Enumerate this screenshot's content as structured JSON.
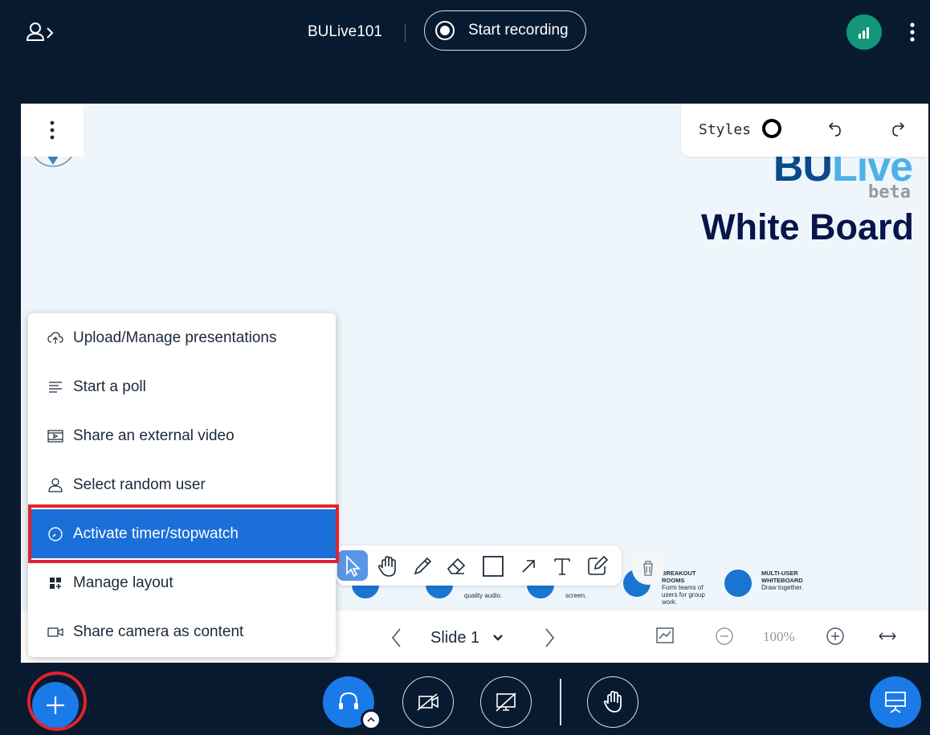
{
  "header": {
    "meeting_title": "BULive101",
    "record_label": "Start recording"
  },
  "presentation": {
    "styles_label": "Styles",
    "slide": {
      "brand_bu": "BU",
      "brand_live": "Live",
      "brand_beta": "beta",
      "title": "White Board",
      "features": [
        {
          "title": "",
          "desc": "quality audio."
        },
        {
          "title": "",
          "desc": "screen."
        },
        {
          "title": "BREAKOUT ROOMS",
          "desc": "Form teams of users for group work."
        },
        {
          "title": "MULTI-USER WHITEBOARD",
          "desc": "Draw together."
        }
      ]
    },
    "nav": {
      "slide_label": "Slide 1",
      "zoom": "100%"
    }
  },
  "actions_menu": {
    "items": [
      {
        "label": "Upload/Manage presentations",
        "icon": "upload-icon"
      },
      {
        "label": "Start a poll",
        "icon": "poll-icon"
      },
      {
        "label": "Share an external video",
        "icon": "video-icon"
      },
      {
        "label": "Select random user",
        "icon": "user-icon"
      },
      {
        "label": "Activate timer/stopwatch",
        "icon": "timer-icon",
        "active": true
      },
      {
        "label": "Manage layout",
        "icon": "layout-icon"
      },
      {
        "label": "Share camera as content",
        "icon": "camera-icon"
      }
    ]
  },
  "colors": {
    "background": "#071a30",
    "accent": "#1a7ae8",
    "menu_active": "#1a6fd8",
    "highlight": "#e3222d",
    "connection": "#14967a"
  }
}
